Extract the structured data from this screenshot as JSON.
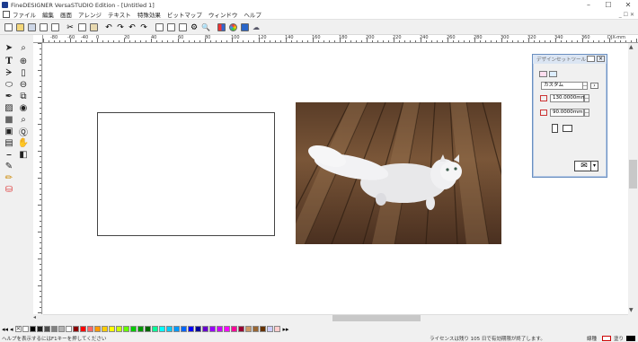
{
  "window": {
    "title": "FineDESIGNER VersaSTUDIO Edition - [Untitled 1]",
    "minimize": "–",
    "maximize": "☐",
    "close": "✕"
  },
  "menu": {
    "items": [
      "ファイル",
      "編集",
      "画面",
      "アレンジ",
      "テキスト",
      "特殊効果",
      "ビットマップ",
      "ウィンドウ",
      "ヘルプ"
    ],
    "doc_controls": "_ ☐ ✕"
  },
  "rulers": {
    "top_labels": [
      "-80",
      "-60",
      "-40",
      "0",
      "20",
      "40",
      "60",
      "80",
      "100",
      "120",
      "140",
      "160",
      "180",
      "200",
      "220",
      "240",
      "260",
      "280",
      "300",
      "320",
      "340",
      "360",
      "DJX-mm"
    ]
  },
  "design_panel": {
    "title": "デザインセットツール",
    "preset": "カスタム",
    "width_value": "130.0000mm",
    "height_value": "90.0000mm"
  },
  "palette": {
    "colors": [
      "#ffffff",
      "#000000",
      "#1a1a1a",
      "#4d4d4d",
      "#808080",
      "#b3b3b3",
      "#ffffff",
      "#8b0000",
      "#ff0000",
      "#ff6666",
      "#ff9900",
      "#ffcc00",
      "#ffff00",
      "#ccff00",
      "#66ff00",
      "#00cc00",
      "#009900",
      "#006600",
      "#00ff99",
      "#00ffff",
      "#00ccff",
      "#0099ff",
      "#0066ff",
      "#0000ff",
      "#000099",
      "#6600cc",
      "#9900ff",
      "#cc00ff",
      "#ff00ff",
      "#ff0099",
      "#990033",
      "#cc9966",
      "#996633",
      "#663300",
      "#ccccff",
      "#ffcccc"
    ]
  },
  "status": {
    "help_text": "ヘルプを表示するにはF1キーを押してください",
    "license_text": "ライセンスは残り 105 日で有効期限が終了します。",
    "fill_label": "塗り",
    "stroke_label": "線種"
  }
}
